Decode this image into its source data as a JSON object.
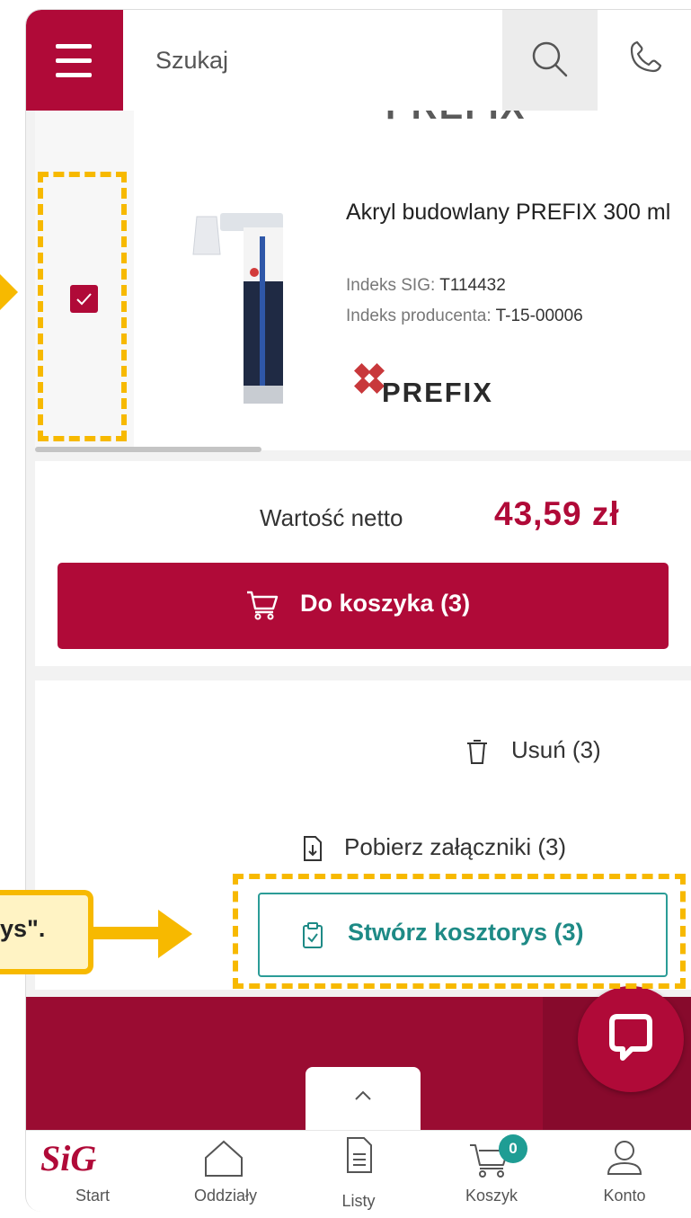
{
  "header": {
    "search_placeholder": "Szukaj"
  },
  "product": {
    "brand_partial": "PREFIX",
    "name": "Akryl budowlany PREFIX 300 ml",
    "sig_index_label": "Indeks SIG:",
    "sig_index_value": "T114432",
    "producer_index_label": "Indeks producenta:",
    "producer_index_value": "T-15-00006",
    "brand_logo_text": "PREFIX",
    "checked": true
  },
  "totals": {
    "netto_label": "Wartość netto",
    "netto_value": "43,59 zł",
    "cart_button_label": "Do koszyka (3)"
  },
  "actions": {
    "delete_label": "Usuń (3)",
    "attachments_label": "Pobierz załączniki (3)",
    "estimate_label": "Stwórz kosztorys (3)"
  },
  "bottom_nav": {
    "items": [
      {
        "label": "Start",
        "icon": "sig-logo-icon"
      },
      {
        "label": "Oddziały",
        "icon": "home-icon"
      },
      {
        "label": "Listy",
        "icon": "document-list-icon"
      },
      {
        "label": "Koszyk",
        "icon": "cart-icon",
        "badge": "0"
      },
      {
        "label": "Konto",
        "icon": "user-icon"
      }
    ]
  },
  "annotation": {
    "callout_text": "ys\"."
  },
  "colors": {
    "brand": "#b00a38",
    "teal": "#2b9c97",
    "highlight": "#f7b900"
  }
}
